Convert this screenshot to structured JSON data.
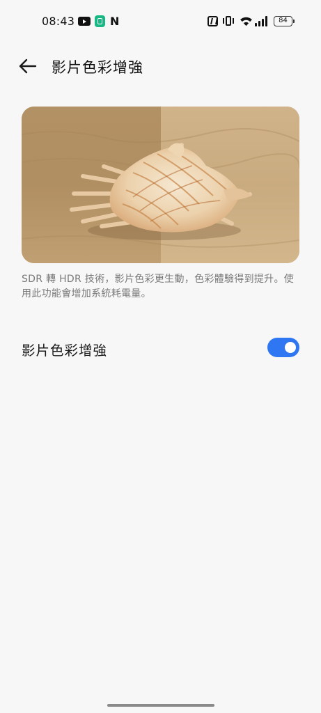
{
  "status_bar": {
    "time": "08:43",
    "n_label": "N",
    "battery_level": "84",
    "icons": [
      "youtube-icon",
      "app-icon",
      "nfc-icon",
      "vibrate-icon",
      "wifi-icon",
      "signal-icon",
      "battery-icon"
    ]
  },
  "header": {
    "title": "影片色彩增強",
    "back_icon": "back-arrow-icon"
  },
  "preview": {
    "subject": "seashell-on-sand"
  },
  "description": "SDR 轉 HDR 技術，影片色彩更生動，色彩體驗得到提升。使用此功能會增加系統耗電量。",
  "setting": {
    "label": "影片色彩增強",
    "enabled": true,
    "accent_color": "#2e76f2"
  }
}
